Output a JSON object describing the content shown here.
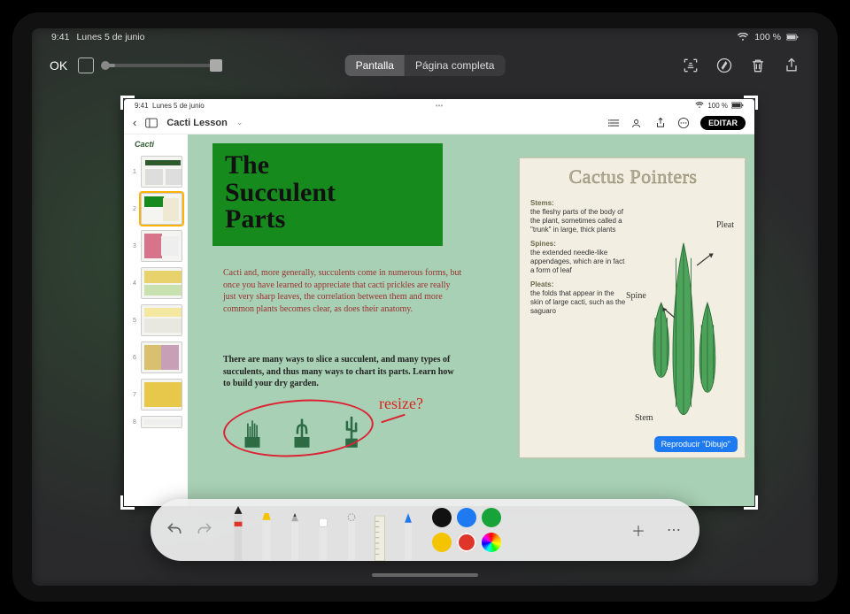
{
  "outer_status": {
    "time": "9:41",
    "date": "Lunes 5 de junio",
    "battery": "100 %"
  },
  "outer_toolbar": {
    "ok": "OK",
    "seg_screen": "Pantalla",
    "seg_full": "Página completa"
  },
  "inner_status": {
    "time": "9:41",
    "date": "Lunes 5 de junio",
    "battery": "100 %"
  },
  "inner_toolbar": {
    "doc_title": "Cacti Lesson",
    "edit": "EDITAR"
  },
  "thumbnails": {
    "heading": "Cacti",
    "count": 8
  },
  "page": {
    "title_line1": "The",
    "title_line2": "Succulent",
    "title_line3": "Parts",
    "intro": "Cacti and, more generally, succulents come in numerous forms, but once you have learned to appreciate that cacti prickles are really just very sharp leaves, the correlation between them and more common plants becomes clear, as does their anatomy.",
    "body2": "There are many ways to slice a succulent, and many types of succulents, and thus many ways to chart its parts. Learn how to build your dry garden.",
    "scribble": "resize?"
  },
  "pointer_card": {
    "title": "Cactus Pointers",
    "stems_h": "Stems:",
    "stems": "the fleshy parts of the body of the plant, sometimes called a \"trunk\" in large, thick plants",
    "spines_h": "Spines:",
    "spines": "the extended needle-like appendages, which are in fact a form of leaf",
    "pleats_h": "Pleats:",
    "pleats": "the folds that appear in the skin of large cacti, such as the saguaro",
    "label_pleat": "Pleat",
    "label_spine": "Spine",
    "label_stem": "Stem",
    "play": "Reproducir \"Dibujo\""
  },
  "colors": {
    "swatches": [
      "#111111",
      "#1e7af0",
      "#18a33a",
      "#f5c400",
      "#e0352b"
    ],
    "selected": "#e0352b"
  }
}
